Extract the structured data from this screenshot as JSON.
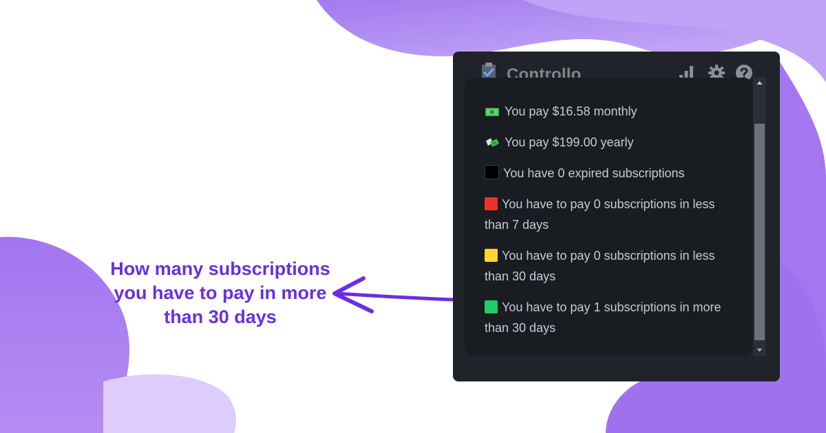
{
  "app": {
    "title": "Controllo"
  },
  "header_buttons": {
    "stats_icon": "bar-chart-icon",
    "settings_icon": "gear-icon",
    "help_icon": "question-circle-icon"
  },
  "stats": [
    {
      "icon": "money-bill-icon",
      "text": "You pay $16.58 monthly"
    },
    {
      "icon": "money-with-wings-icon",
      "text": "You pay $199.00 yearly"
    },
    {
      "icon": "black-square-icon",
      "color": "#000000",
      "text": "You have 0 expired subscriptions"
    },
    {
      "icon": "red-square-icon",
      "color": "#f0302b",
      "text": "You have to pay 0 subscriptions in less than 7 days"
    },
    {
      "icon": "yellow-square-icon",
      "color": "#fcd535",
      "text": "You have to pay 0 subscriptions in less than 30 days"
    },
    {
      "icon": "green-square-icon",
      "color": "#1fce6a",
      "text": "You have to pay 1 subscriptions in more than 30 days"
    }
  ],
  "annotation": {
    "text": "How many subscriptions you have to pay in more than 30 days",
    "color": "#6a2fe0"
  },
  "colors": {
    "blob_primary": "#a77cf2",
    "blob_light": "#c9acf8",
    "window_bg": "#202329",
    "panel_bg": "#191c21"
  }
}
